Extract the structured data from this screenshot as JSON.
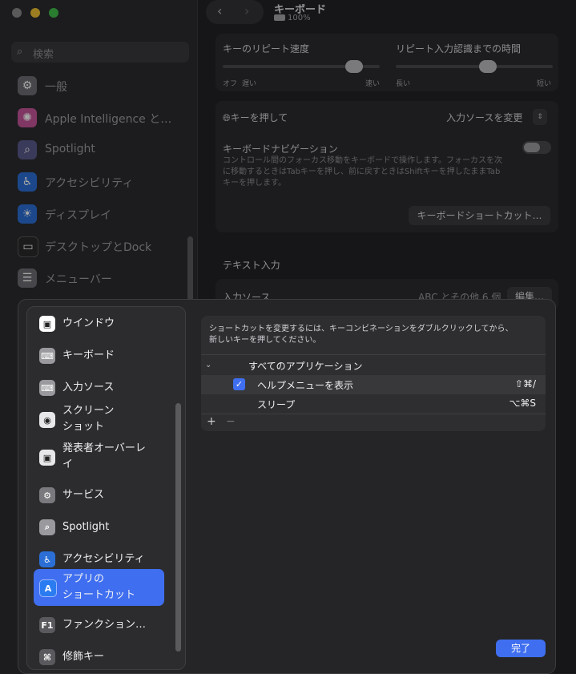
{
  "window": {
    "title": "キーボード",
    "battery": "100%"
  },
  "sidebar": {
    "search_placeholder": "検索",
    "items": [
      {
        "label": "一般",
        "icon": "gear-icon",
        "color": "#6e6e73"
      },
      {
        "label": "Apple Intelligence と…",
        "icon": "apple-intelligence-icon",
        "color": "#c5559a"
      },
      {
        "label": "Spotlight",
        "icon": "magnifier-icon",
        "color": "#5a5a8a"
      },
      {
        "label": "アクセシビリティ",
        "icon": "accessibility-icon",
        "color": "#2b6fd6"
      },
      {
        "label": "ディスプレイ",
        "icon": "sun-icon",
        "color": "#2b6fd6"
      },
      {
        "label": "デスクトップとDock",
        "icon": "dock-icon",
        "color": "#2a2a2c"
      },
      {
        "label": "メニューバー",
        "icon": "menubar-icon",
        "color": "#6e6e73"
      }
    ]
  },
  "keyboard": {
    "repeat_rate_label": "キーのリピート速度",
    "repeat_rate_min": "オフ",
    "repeat_rate_slow": "遅い",
    "repeat_rate_fast": "速い",
    "repeat_rate_level": 0.88,
    "delay_label": "リピート入力認識までの時間",
    "delay_long": "長い",
    "delay_short": "短い",
    "delay_level": 0.6,
    "globe_label": "キーを押して",
    "globe_value": "入力ソースを変更",
    "nav_label": "キーボードナビゲーション",
    "nav_desc_1": "コントロール間のフォーカス移動をキーボードで操作します。フォーカスを次",
    "nav_desc_2": "に移動するときはTabキーを押し、前に戻すときはShiftキーを押したままTab",
    "nav_desc_3": "キーを押します。",
    "shortcuts_button": "キーボードショートカット…",
    "text_input_header": "テキスト入力",
    "input_sources_label": "入力ソース",
    "input_sources_value": "ABC とその他 6 個",
    "edit_button": "編集…"
  },
  "sheet": {
    "categories": [
      {
        "label": "ウインドウ",
        "icon": "window-icon",
        "color": "#ffffff"
      },
      {
        "label": "キーボード",
        "icon": "keyboard-icon",
        "color": "#9a9a9e"
      },
      {
        "label": "入力ソース",
        "icon": "input-source-icon",
        "color": "#9a9a9e"
      },
      {
        "label": "スクリーン",
        "label2": "ショット",
        "icon": "screenshot-icon",
        "color": "#e8e8ea"
      },
      {
        "label": "発表者オーバーレ",
        "label2": "イ",
        "icon": "presenter-icon",
        "color": "#e8e8ea"
      },
      {
        "label": "サービス",
        "icon": "services-icon",
        "color": "#7a7a7e"
      },
      {
        "label": "Spotlight",
        "icon": "spotlight-icon",
        "color": "#9a9a9e"
      },
      {
        "label": "アクセシビリティ",
        "icon": "accessibility-icon",
        "color": "#2b6fd6"
      },
      {
        "label": "アプリの",
        "label2": "ショートカット",
        "icon": "app-store-icon",
        "color": "#2b7cf0",
        "selected": true
      },
      {
        "label": "ファンクション…",
        "icon": "fn-icon",
        "color": "#5a5a5e"
      },
      {
        "label": "修飾キー",
        "icon": "command-icon",
        "color": "#5a5a5e"
      }
    ],
    "note_line1": "ショートカットを変更するには、キーコンビネーションをダブルクリックしてから、",
    "note_line2": "新しいキーを押してください。",
    "group_label": "すべてのアプリケーション",
    "rows": [
      {
        "label": "ヘルプメニューを表示",
        "keys": "⇧⌘/",
        "checked": true
      },
      {
        "label": "スリープ",
        "keys": "⌥⌘S",
        "checked": false
      }
    ],
    "add_button": "+",
    "remove_button": "−",
    "done_button": "完了"
  }
}
